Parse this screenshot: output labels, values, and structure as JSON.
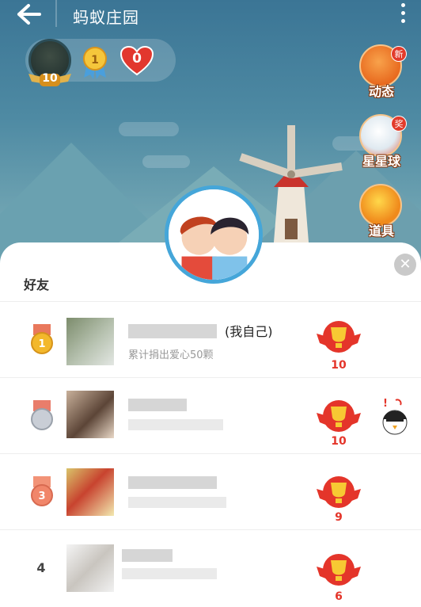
{
  "header": {
    "title": "蚂蚁庄园"
  },
  "stats": {
    "level": "10",
    "hearts": "0"
  },
  "side_buttons": [
    {
      "label": "动态",
      "tag": "新"
    },
    {
      "label": "星星球",
      "tag": "奖"
    },
    {
      "label": "道具",
      "tag": ""
    }
  ],
  "panel": {
    "section_label": "好友",
    "close_symbol": "✕",
    "rows": [
      {
        "rank": "1",
        "name_suffix": "(我自己)",
        "sub": "累计捐出爱心50颗",
        "trophies": "10"
      },
      {
        "rank": "2",
        "trophies": "10"
      },
      {
        "rank": "3",
        "trophies": "9"
      },
      {
        "rank": "4",
        "trophies": "6"
      }
    ]
  },
  "colors": {
    "accent": "#e4352a",
    "sky": "#3b7595",
    "ring": "#45a6d9"
  }
}
